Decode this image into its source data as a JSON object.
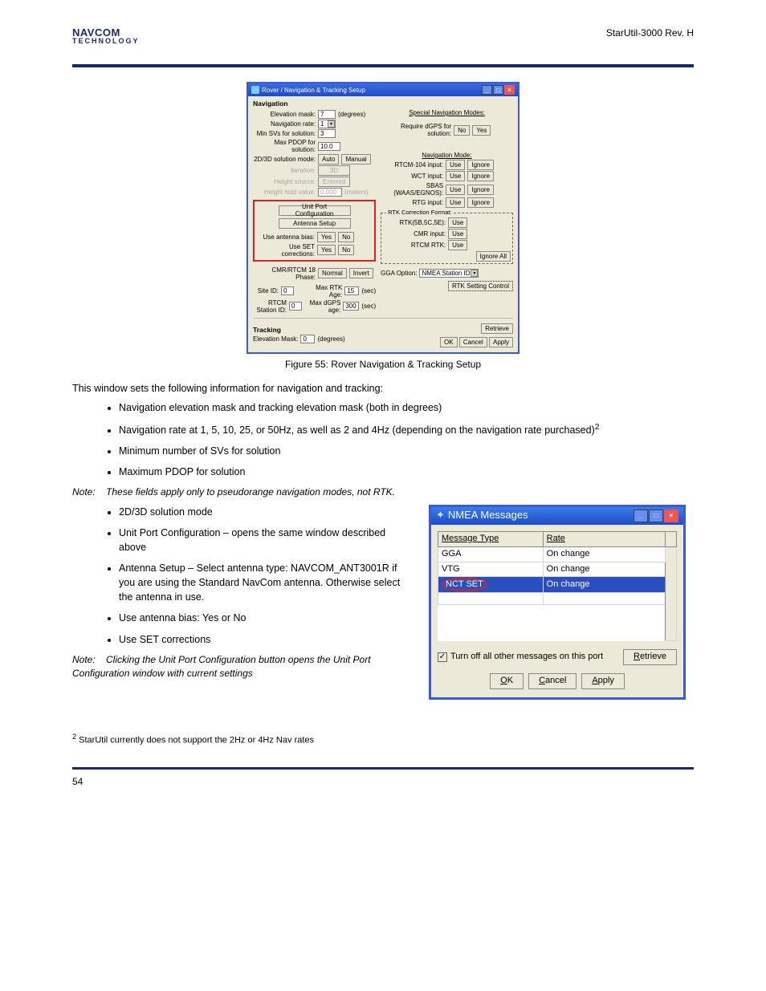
{
  "header": {
    "logo_main": "NAVCOM",
    "logo_sub": "TECHNOLOGY",
    "doc_title": "StarUtil-3000 Rev. H"
  },
  "figure55": {
    "caption": "Figure 55: Rover Navigation & Tracking Setup",
    "window": {
      "title": "Rover / Navigation & Tracking Setup",
      "nav_heading": "Navigation",
      "elev_mask_label": "Elevation mask:",
      "elev_mask_value": "7",
      "degrees": "(degrees)",
      "nav_rate_label": "Navigation rate:",
      "nav_rate_value": "1",
      "min_sv_label": "Min SVs for solution:",
      "min_sv_value": "3",
      "max_pdop_label": "Max PDOP for solution:",
      "max_pdop_value": "10.0",
      "mode2d3d_label": "2D/3D solution mode:",
      "auto": "Auto",
      "manual": "Manual",
      "iteration": "Iteration:",
      "threeD": "3D",
      "height_source": "Height source:",
      "entered": "Entered",
      "height_hold_label": "Height hold value:",
      "height_hold_value": "0.000",
      "meters": "(meters)",
      "unit_port_btn": "Unit Port Configuration",
      "antenna_btn": "Antenna Setup",
      "use_ant_label": "Use antenna bias:",
      "yes": "Yes",
      "no": "No",
      "use_set_label": "Use SET corrections:",
      "cmr_phase_label": "CMR/RTCM 18 Phase:",
      "normal": "Normal",
      "invert": "Invert",
      "site_id_label": "Site ID:",
      "site_id_value": "0",
      "max_rtk_label": "Max RTK Age:",
      "max_rtk_value": "15",
      "sec": "(sec)",
      "rtcm_station_label": "RTCM Station ID:",
      "rtcm_station_value": "0",
      "max_dgps_label": "Max dGPS age:",
      "max_dgps_value": "300",
      "special_nav_modes": "Special Navigation Modes:",
      "req_dgps": "Require dGPS for solution:",
      "nav_mode_heading": "Navigation Mode:",
      "rtcm104": "RTCM-104 input:",
      "wct": "WCT input:",
      "sbas": "SBAS (WAAS/EGNOS):",
      "rtg": "RTG input:",
      "use": "Use",
      "ignore": "Ignore",
      "rtk_corr_group": "RTK Correction Format:",
      "rtk5e": "RTK(5B,5C,5E):",
      "cmr_in": "CMR input:",
      "rtcm_rtk": "RTCM RTK:",
      "ignore_all": "Ignore All",
      "gga_option": "GGA Option:",
      "gga_value": "NMEA Station ID",
      "rtk_setting_btn": "RTK Setting Control",
      "tracking_heading": "Tracking",
      "tracking_elev": "Elevation Mask:",
      "tracking_elev_value": "0",
      "retrieve": "Retrieve",
      "ok": "OK",
      "cancel": "Cancel",
      "apply": "Apply"
    }
  },
  "prose": {
    "intro": "This window sets the following information for navigation and tracking:",
    "li1": "Navigation elevation mask and tracking elevation mask (both in degrees)",
    "li2": "Navigation rate at 1, 5, 10, 25, or 50Hz, as well as 2 and 4Hz (depending on the navigation rate purchased)",
    "li3": "Minimum number of SVs for solution",
    "li4": "Maximum PDOP for solution",
    "li4_sub": "Note:    These fields apply only to pseudorange navigation modes, not RTK.",
    "li5": "2D/3D solution mode",
    "li6": "Unit Port Configuration – opens the same window described above",
    "li7": "Antenna Setup – Select antenna type: NAVCOM_ANT3001R if you are using the Standard NavCom antenna. Otherwise select the antenna in use.",
    "li8": "Use antenna bias: Yes or No",
    "li9": "Use SET corrections",
    "li9_sub": "Note:    Clicking the Unit Port Configuration button opens the Unit Port Configuration window with current settings",
    "footnote": "StarUtil currently does not support the 2Hz or 4Hz Nav rates"
  },
  "nmea": {
    "title": "NMEA Messages",
    "col_type": "Message Type",
    "col_rate": "Rate",
    "rows": [
      {
        "type": "GGA",
        "rate": "On change"
      },
      {
        "type": "VTG",
        "rate": "On change"
      },
      {
        "type": "NCT SET",
        "rate": "On change"
      }
    ],
    "turnoff": "Turn off all other messages on this port",
    "retrieve": "Retrieve",
    "ok": "OK",
    "cancel": "Cancel",
    "apply": "Apply"
  },
  "footer": {
    "left": "54",
    "right": ""
  }
}
